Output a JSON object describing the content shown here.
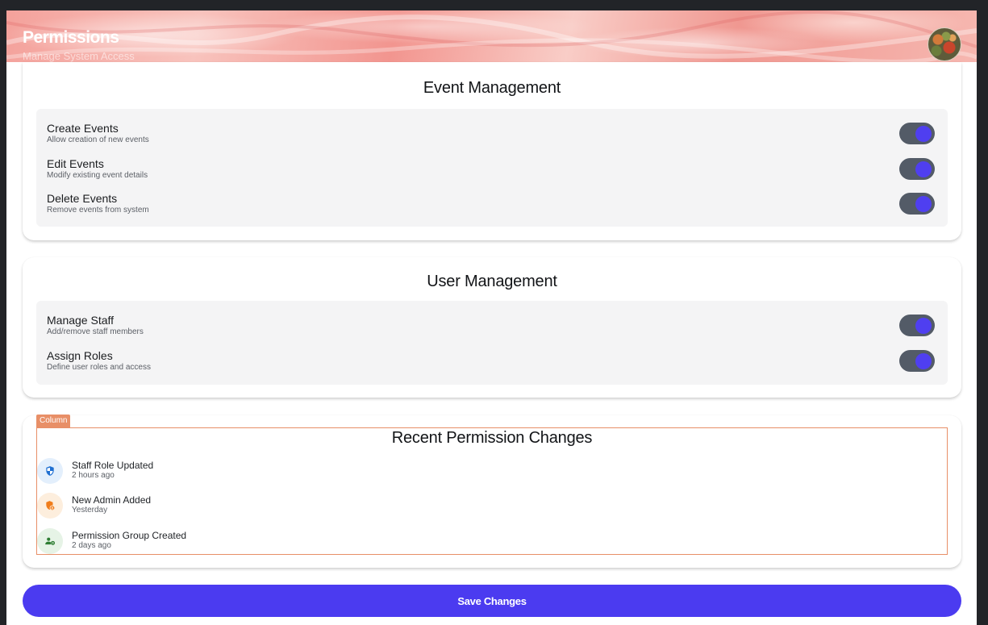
{
  "header": {
    "title": "Permissions",
    "subtitle": "Manage System Access"
  },
  "colors": {
    "accent": "#4f3ff0",
    "toggle_track": "#535b67",
    "column_outline": "#e88f67"
  },
  "event_management": {
    "title": "Event Management",
    "items": [
      {
        "label": "Create Events",
        "description": "Allow creation of new events",
        "enabled": true
      },
      {
        "label": "Edit Events",
        "description": "Modify existing event details",
        "enabled": true
      },
      {
        "label": "Delete Events",
        "description": "Remove events from system",
        "enabled": true
      }
    ]
  },
  "user_management": {
    "title": "User Management",
    "items": [
      {
        "label": "Manage Staff",
        "description": "Add/remove staff members",
        "enabled": true
      },
      {
        "label": "Assign Roles",
        "description": "Define user roles and access",
        "enabled": true
      }
    ]
  },
  "recent_changes": {
    "tag": "Column",
    "title": "Recent Permission Changes",
    "items": [
      {
        "title": "Staff Role Updated",
        "time": "2 hours ago",
        "icon": "shield-icon",
        "color": "#1f6fd1"
      },
      {
        "title": "New Admin Added",
        "time": "Yesterday",
        "icon": "admin-shield-icon",
        "color": "#f07c1a"
      },
      {
        "title": "Permission Group Created",
        "time": "2 days ago",
        "icon": "group-settings-icon",
        "color": "#2e7d32"
      }
    ]
  },
  "actions": {
    "save_label": "Save Changes"
  }
}
